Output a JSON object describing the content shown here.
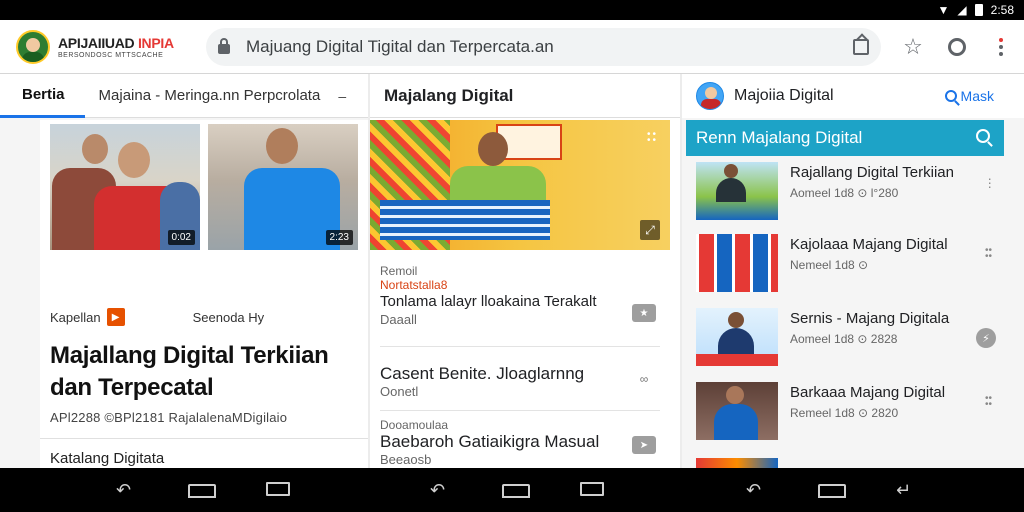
{
  "status": {
    "time": "2:58"
  },
  "browser": {
    "logo_title_a": "APIJAIIUAD ",
    "logo_title_b": "INPIA",
    "logo_sub": "BERSONDOSC MTTSCACHE",
    "url": "Majuang Digital Tigital dan Terpercata.an"
  },
  "pane1": {
    "tab_active": "Bertia",
    "tab_second": "Majaina - Meringa.nn Perpcrolata",
    "thumbs": [
      {
        "duration": "0:02"
      },
      {
        "duration": "2:23"
      }
    ],
    "category": "Kapellan",
    "source": "Seenoda Hy",
    "headline": "Majallang Digital Terkiian dan Terpecatal",
    "subline": "APl2288 ©BPl2181 RajalalenaMDigilaio",
    "section_title": "Katalang Digitata"
  },
  "pane2": {
    "title": "Majalang Digital",
    "items": [
      {
        "kicker": "Remoil",
        "kicker2": "Nortatstalla8",
        "title": "Tonlama lalayr lloakaina Terakalt",
        "source": "Daaall"
      },
      {
        "kicker": "",
        "kicker2": "",
        "title": "Casent Benite. Jloaglarnng",
        "source": "Oonetl"
      },
      {
        "kicker": "Dooamoulaa",
        "kicker2": "",
        "title": "Baebaroh Gatiaikigra Masual",
        "source": "Beeaosb"
      }
    ]
  },
  "pane3": {
    "channel_title": "Majoiia Digital",
    "search_label": "Mask",
    "bar_title": "Renn Majalang Digital",
    "items": [
      {
        "title": "Rajallang Digital Terkiian",
        "meta": "Aomeel 1d8 ⊙ l°280"
      },
      {
        "title": "Kajolaaa Majang Digital",
        "meta": "Nemeel 1d8 ⊙"
      },
      {
        "title": "Sernis - Majang Digitala",
        "meta": "Aomeel 1d8 ⊙ 2828"
      },
      {
        "title": "Barkaaa Majang Digital",
        "meta": "Remeel 1d8 ⊙ 2820"
      }
    ]
  }
}
